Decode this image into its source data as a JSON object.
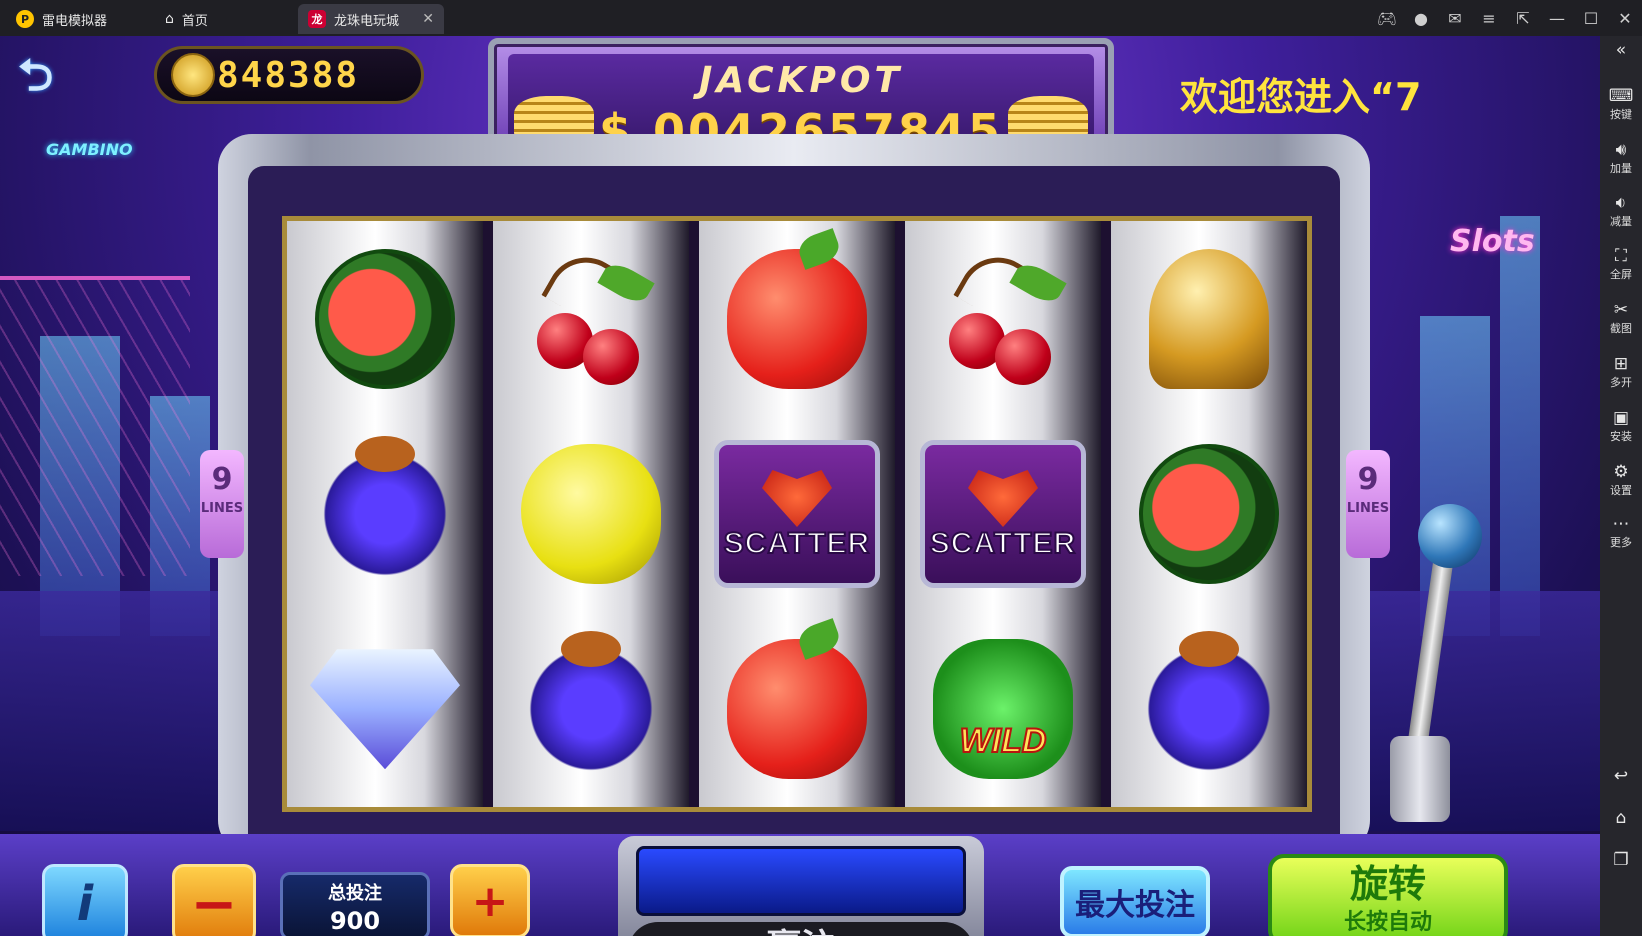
{
  "titlebar": {
    "app_name": "雷电模拟器",
    "home_tab": "首页",
    "game_tab": "龙珠电玩城",
    "close_tab": "✕"
  },
  "window_controls": [
    "gamepad-icon",
    "user-icon",
    "mail-icon",
    "menu-icon",
    "export-icon",
    "minimize-icon",
    "maximize-icon",
    "close-icon"
  ],
  "sidebar": {
    "collapse": "«",
    "items": [
      {
        "label": "按键",
        "icon": "keyboard-icon"
      },
      {
        "label": "加量",
        "icon": "volume-up-icon"
      },
      {
        "label": "减量",
        "icon": "volume-down-icon"
      },
      {
        "label": "全屏",
        "icon": "fullscreen-icon"
      },
      {
        "label": "截图",
        "icon": "scissors-icon"
      },
      {
        "label": "多开",
        "icon": "multi-open-icon"
      },
      {
        "label": "安装",
        "icon": "apk-icon"
      },
      {
        "label": "设置",
        "icon": "gear-icon"
      },
      {
        "label": "更多",
        "icon": "more-icon"
      }
    ],
    "nav": [
      "back-icon",
      "home-icon",
      "recent-icon"
    ]
  },
  "game": {
    "balance": "848388",
    "jackpot_title": "JACKPOT",
    "jackpot_value": "$ 0042657845",
    "welcome": "欢迎您进入“7",
    "lines_count": "9",
    "lines_label": "LINES",
    "brand_left": "GAMBINO",
    "brand_right": "Slots",
    "reels": [
      [
        "watermelon",
        "grapes",
        "diamond"
      ],
      [
        "cherry",
        "lemon",
        "grapes"
      ],
      [
        "apple",
        "scatter",
        "apple"
      ],
      [
        "cherry",
        "scatter",
        "wild"
      ],
      [
        "bell",
        "watermelon",
        "grapes"
      ]
    ],
    "scatter_text": "SCATTER",
    "wild_text": "WILD",
    "info_label": "i",
    "minus_label": "−",
    "plus_label": "+",
    "total_bet_label": "总投注",
    "total_bet_value": "900",
    "win_label": "赢注",
    "max_bet_label": "最大投注",
    "spin_label": "旋转",
    "spin_sub": "长按自动"
  }
}
